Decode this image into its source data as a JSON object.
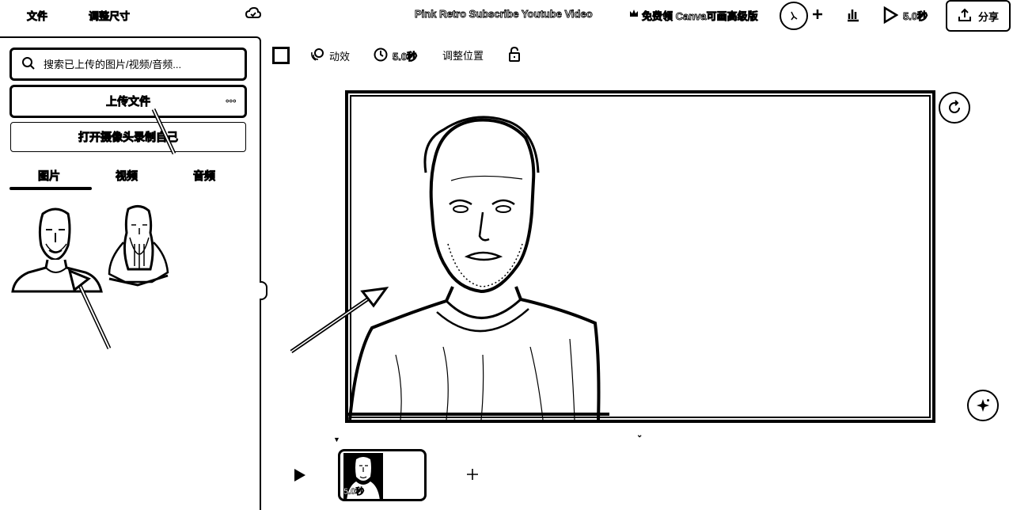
{
  "topbar": {
    "file_label": "文件",
    "resize_label": "调整尺寸",
    "project_title": "Pink Retro Subscribe Youtube Video",
    "promo_label": "免费领 Canva可画高级版",
    "duration_label": "5.0秒",
    "share_label": "分享"
  },
  "sidebar": {
    "search_placeholder": "搜索已上传的图片/视频/音频...",
    "upload_label": "上传文件",
    "upload_more": "•••",
    "camera_label": "打开摄像头录制自己",
    "tabs": [
      {
        "label": "图片"
      },
      {
        "label": "视频"
      },
      {
        "label": "音频"
      }
    ],
    "active_tab": 0
  },
  "toolbar": {
    "animate_label": "动效",
    "time_label": "5.0秒",
    "position_label": "调整位置"
  },
  "timeline": {
    "clip_duration": "5.0秒"
  },
  "icons": {
    "search": "search-icon",
    "share": "upload-arrow-icon",
    "play": "play-icon",
    "animate": "animate-icon",
    "clock": "clock-icon",
    "lock": "lock-icon",
    "rotate": "rotate-icon",
    "magic": "sparkle-icon"
  }
}
